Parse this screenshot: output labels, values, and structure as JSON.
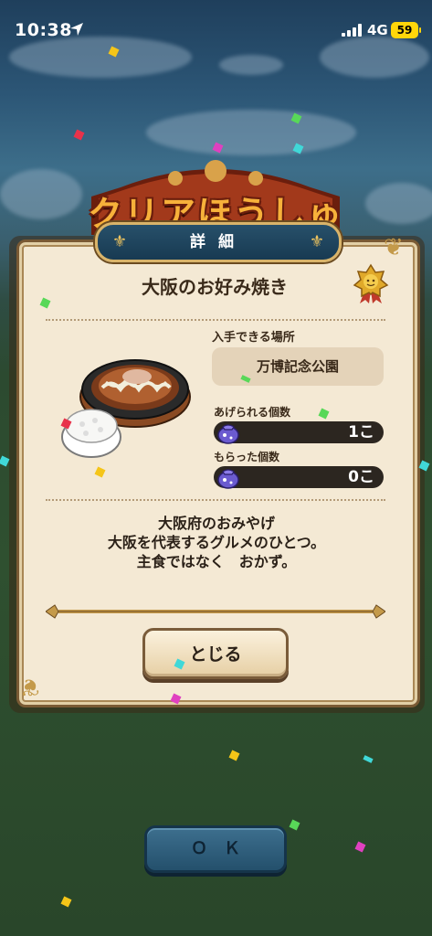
{
  "status_bar": {
    "time": "10:38",
    "network": "4G",
    "battery": "59"
  },
  "header": {
    "banner_title": "クリアほうしゅう",
    "tab_title": "詳細"
  },
  "item": {
    "name": "大阪のお好み焼き",
    "location_label": "入手できる場所",
    "location_value": "万博記念公園",
    "giftable_label": "あげられる個数",
    "giftable_value": "1こ",
    "received_label": "もらった個数",
    "received_value": "0こ",
    "description": [
      "大阪府のおみやげ",
      "大阪を代表するグルメのひとつ。",
      "主食ではなく　おかず。"
    ]
  },
  "buttons": {
    "close_label": "とじる",
    "ok_label": "ＯＫ"
  },
  "colors": {
    "tab": "#1f4660",
    "panel": "#f4e9d4",
    "gold": "#d9b46a",
    "banner_text": "#f7b13a"
  }
}
